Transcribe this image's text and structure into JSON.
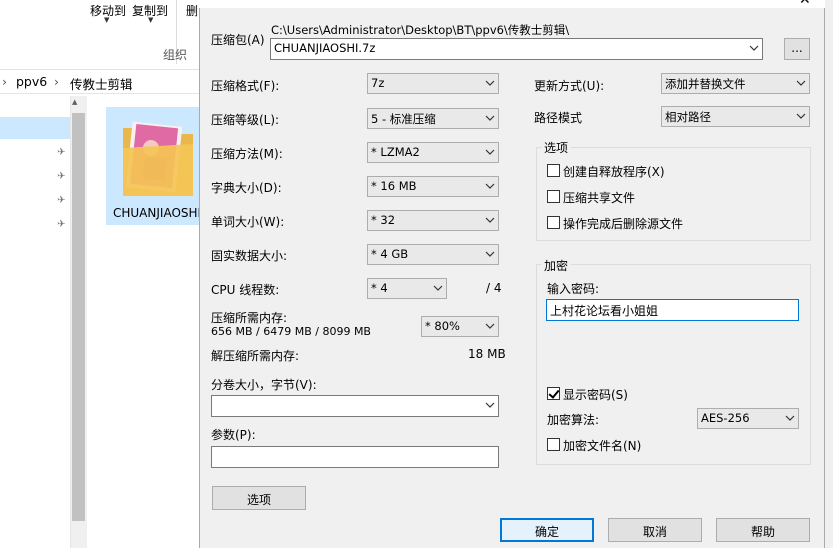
{
  "explorer": {
    "ribbon": {
      "move_to": "移动到",
      "copy_to": "复制到",
      "delete_partial": "删",
      "group_label": "组织"
    },
    "breadcrumb": [
      "ppv6",
      "传教士剪辑"
    ],
    "file": {
      "name": "CHUANJIAOSHI"
    }
  },
  "dialog": {
    "archive_label": "压缩包(A)",
    "archive_path": "C:\\Users\\Administrator\\Desktop\\BT\\ppv6\\传教士剪辑\\",
    "archive_name": "CHUANJIAOSHI.7z",
    "browse_label": "...",
    "format": {
      "label": "压缩格式(F):",
      "value": "7z"
    },
    "level": {
      "label": "压缩等级(L):",
      "value": "5 - 标准压缩"
    },
    "method": {
      "label": "压缩方法(M):",
      "value": "* LZMA2"
    },
    "dict": {
      "label": "字典大小(D):",
      "value": "* 16 MB"
    },
    "word": {
      "label": "单词大小(W):",
      "value": "* 32"
    },
    "solid": {
      "label": "固实数据大小:",
      "value": "* 4 GB"
    },
    "cpu": {
      "label": "CPU 线程数:",
      "value": "* 4",
      "max": "/ 4"
    },
    "memory": {
      "label": "压缩所需内存:",
      "detail": "656 MB / 6479 MB / 8099 MB",
      "value": "* 80%"
    },
    "decomp": {
      "label": "解压缩所需内存:",
      "value": "18 MB"
    },
    "split": {
      "label": "分卷大小，字节(V):",
      "value": ""
    },
    "params": {
      "label": "参数(P):",
      "value": ""
    },
    "options_button": "选项",
    "update": {
      "label": "更新方式(U):",
      "value": "添加并替换文件"
    },
    "pathmode": {
      "label": "路径模式",
      "value": "相对路径"
    },
    "options_group": {
      "title": "选项",
      "items": [
        {
          "label": "创建自释放程序(X)",
          "checked": false
        },
        {
          "label": "压缩共享文件",
          "checked": false
        },
        {
          "label": "操作完成后删除源文件",
          "checked": false
        }
      ]
    },
    "encryption": {
      "title": "加密",
      "password_label": "输入密码:",
      "password_value": "上村花论坛看小姐姐",
      "show_password": {
        "label": "显示密码(S)",
        "checked": true
      },
      "method_label": "加密算法:",
      "method_value": "AES-256",
      "encrypt_names": {
        "label": "加密文件名(N)",
        "checked": false
      }
    },
    "ok": "确定",
    "cancel": "取消",
    "help": "帮助"
  }
}
